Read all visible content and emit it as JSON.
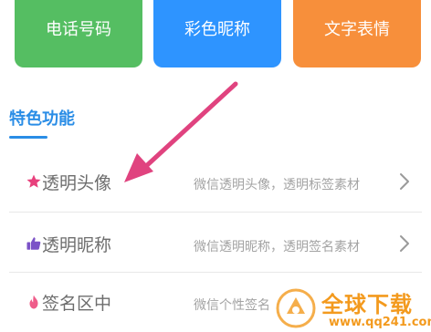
{
  "tiles": [
    {
      "label": "电话号码",
      "color": "#55be62"
    },
    {
      "label": "彩色昵称",
      "color": "#2e94ff"
    },
    {
      "label": "文字表情",
      "color": "#f78f3b"
    }
  ],
  "section": {
    "title": "特色功能",
    "accent": "#2a8de6"
  },
  "features": [
    {
      "icon": "star-icon",
      "icon_color": "#e8407c",
      "title": "透明头像",
      "desc": "微信透明头像，透明标签素材"
    },
    {
      "icon": "thumbs-up-icon",
      "icon_color": "#7b52c7",
      "title": "透明昵称",
      "desc": "微信透明昵称，透明签名素材"
    },
    {
      "icon": "flame-icon",
      "icon_color": "#ef5c8a",
      "title": "签名区中",
      "desc": "微信个性签名"
    }
  ],
  "annotation": {
    "arrow_color": "#e0437f"
  },
  "watermark": {
    "brand": "全球下载",
    "url": "www.qq241.com",
    "color": "#f39a1e"
  }
}
